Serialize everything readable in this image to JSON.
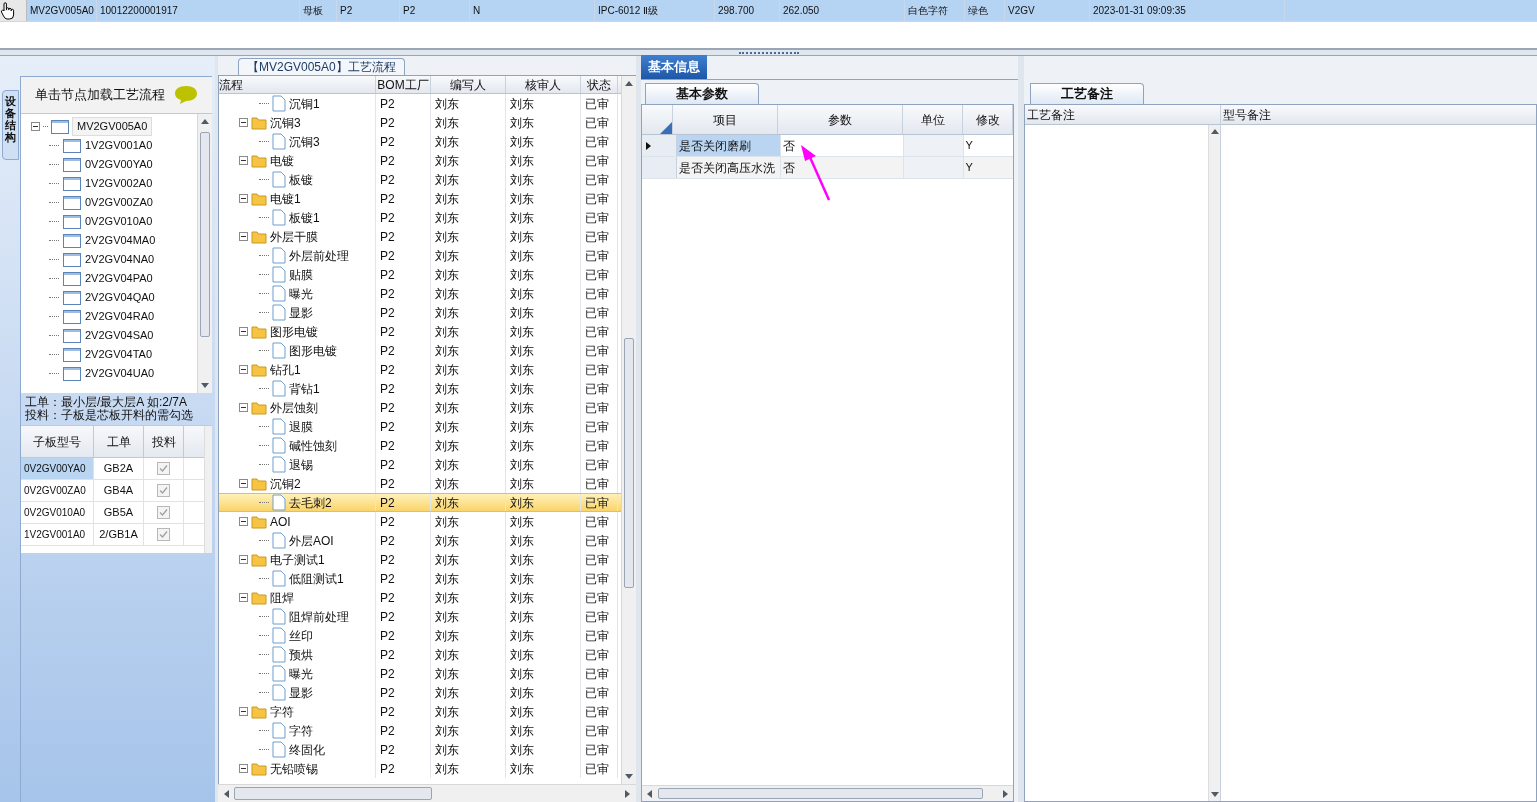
{
  "top_grid": {
    "row": {
      "selected": true,
      "cells": [
        "MV2GV005A0",
        "10012200001917",
        "母板",
        "P2",
        "P2",
        "N",
        "IPC-6012 Ⅱ级",
        "298.700",
        "262.050",
        "白色字符",
        "绿色",
        "V2GV",
        "2023-01-31 09:09:35"
      ]
    }
  },
  "left_panel": {
    "side_tab": "设备结构",
    "header": "单击节点加载工艺流程",
    "tree": {
      "label": "MV2GV005A0",
      "expanded": true,
      "selected": true,
      "children": [
        {
          "label": "1V2GV001A0"
        },
        {
          "label": "0V2GV00YA0"
        },
        {
          "label": "1V2GV002A0"
        },
        {
          "label": "0V2GV00ZA0"
        },
        {
          "label": "0V2GV010A0"
        },
        {
          "label": "2V2GV04MA0"
        },
        {
          "label": "2V2GV04NA0"
        },
        {
          "label": "2V2GV04PA0"
        },
        {
          "label": "2V2GV04QA0"
        },
        {
          "label": "2V2GV04RA0"
        },
        {
          "label": "2V2GV04SA0"
        },
        {
          "label": "2V2GV04TA0"
        },
        {
          "label": "2V2GV04UA0"
        }
      ]
    },
    "note": [
      "工单：最小层/最大层A 如:2/7A",
      "投料：子板是芯板开料的需勾选"
    ],
    "sub_grid": {
      "columns": [
        "子板型号",
        "工单",
        "投料"
      ],
      "rows": [
        {
          "model": "0V2GV00YA0",
          "order": "GB2A",
          "checked": true,
          "selected": true
        },
        {
          "model": "0V2GV00ZA0",
          "order": "GB4A",
          "checked": true,
          "selected": false
        },
        {
          "model": "0V2GV010A0",
          "order": "GB5A",
          "checked": true,
          "selected": false
        },
        {
          "model": "1V2GV001A0",
          "order": "2/GB1A",
          "checked": true,
          "selected": false
        }
      ]
    }
  },
  "flow": {
    "title": "【MV2GV005A0】工艺流程",
    "columns": [
      "流程",
      "BOM工厂",
      "编写人",
      "核审人",
      "状态"
    ],
    "rows": [
      {
        "children": [
          {
            "label": "沉铜1",
            "bom": "P2",
            "writer": "刘东",
            "reviewer": "刘东",
            "status": "已审",
            "selected": false
          }
        ]
      },
      {
        "label": "沉铜3",
        "expanded": true,
        "bom": "P2",
        "writer": "刘东",
        "reviewer": "刘东",
        "status": "已审",
        "selected": false,
        "children": [
          {
            "label": "沉铜3",
            "bom": "P2",
            "writer": "刘东",
            "reviewer": "刘东",
            "status": "已审",
            "selected": false
          }
        ]
      },
      {
        "label": "电镀",
        "expanded": true,
        "bom": "P2",
        "writer": "刘东",
        "reviewer": "刘东",
        "status": "已审",
        "selected": false,
        "children": [
          {
            "label": "板镀",
            "bom": "P2",
            "writer": "刘东",
            "reviewer": "刘东",
            "status": "已审",
            "selected": false
          }
        ]
      },
      {
        "label": "电镀1",
        "expanded": true,
        "bom": "P2",
        "writer": "刘东",
        "reviewer": "刘东",
        "status": "已审",
        "selected": false,
        "children": [
          {
            "label": "板镀1",
            "bom": "P2",
            "writer": "刘东",
            "reviewer": "刘东",
            "status": "已审",
            "selected": false
          }
        ]
      },
      {
        "label": "外层干膜",
        "expanded": true,
        "bom": "P2",
        "writer": "刘东",
        "reviewer": "刘东",
        "status": "已审",
        "selected": false,
        "children": [
          {
            "label": "外层前处理",
            "bom": "P2",
            "writer": "刘东",
            "reviewer": "刘东",
            "status": "已审",
            "selected": false
          },
          {
            "label": "贴膜",
            "bom": "P2",
            "writer": "刘东",
            "reviewer": "刘东",
            "status": "已审",
            "selected": false
          },
          {
            "label": "曝光",
            "bom": "P2",
            "writer": "刘东",
            "reviewer": "刘东",
            "status": "已审",
            "selected": false
          },
          {
            "label": "显影",
            "bom": "P2",
            "writer": "刘东",
            "reviewer": "刘东",
            "status": "已审",
            "selected": false
          }
        ]
      },
      {
        "label": "图形电镀",
        "expanded": true,
        "bom": "P2",
        "writer": "刘东",
        "reviewer": "刘东",
        "status": "已审",
        "selected": false,
        "children": [
          {
            "label": "图形电镀",
            "bom": "P2",
            "writer": "刘东",
            "reviewer": "刘东",
            "status": "已审",
            "selected": false
          }
        ]
      },
      {
        "label": "钻孔1",
        "expanded": true,
        "bom": "P2",
        "writer": "刘东",
        "reviewer": "刘东",
        "status": "已审",
        "selected": false,
        "children": [
          {
            "label": "背钻1",
            "bom": "P2",
            "writer": "刘东",
            "reviewer": "刘东",
            "status": "已审",
            "selected": false
          }
        ]
      },
      {
        "label": "外层蚀刻",
        "expanded": true,
        "bom": "P2",
        "writer": "刘东",
        "reviewer": "刘东",
        "status": "已审",
        "selected": false,
        "children": [
          {
            "label": "退膜",
            "bom": "P2",
            "writer": "刘东",
            "reviewer": "刘东",
            "status": "已审",
            "selected": false
          },
          {
            "label": "碱性蚀刻",
            "bom": "P2",
            "writer": "刘东",
            "reviewer": "刘东",
            "status": "已审",
            "selected": false
          },
          {
            "label": "退锡",
            "bom": "P2",
            "writer": "刘东",
            "reviewer": "刘东",
            "status": "已审",
            "selected": false
          }
        ]
      },
      {
        "label": "沉铜2",
        "expanded": true,
        "bom": "P2",
        "writer": "刘东",
        "reviewer": "刘东",
        "status": "已审",
        "selected": false,
        "children": [
          {
            "label": "去毛刺2",
            "bom": "P2",
            "writer": "刘东",
            "reviewer": "刘东",
            "status": "已审",
            "selected": true
          }
        ]
      },
      {
        "label": "AOI",
        "expanded": true,
        "bom": "P2",
        "writer": "刘东",
        "reviewer": "刘东",
        "status": "已审",
        "selected": false,
        "children": [
          {
            "label": "外层AOI",
            "bom": "P2",
            "writer": "刘东",
            "reviewer": "刘东",
            "status": "已审",
            "selected": false
          }
        ]
      },
      {
        "label": "电子测试1",
        "expanded": true,
        "bom": "P2",
        "writer": "刘东",
        "reviewer": "刘东",
        "status": "已审",
        "selected": false,
        "children": [
          {
            "label": "低阻测试1",
            "bom": "P2",
            "writer": "刘东",
            "reviewer": "刘东",
            "status": "已审",
            "selected": false
          }
        ]
      },
      {
        "label": "阻焊",
        "expanded": true,
        "bom": "P2",
        "writer": "刘东",
        "reviewer": "刘东",
        "status": "已审",
        "selected": false,
        "children": [
          {
            "label": "阻焊前处理",
            "bom": "P2",
            "writer": "刘东",
            "reviewer": "刘东",
            "status": "已审",
            "selected": false
          },
          {
            "label": "丝印",
            "bom": "P2",
            "writer": "刘东",
            "reviewer": "刘东",
            "status": "已审",
            "selected": false
          },
          {
            "label": "预烘",
            "bom": "P2",
            "writer": "刘东",
            "reviewer": "刘东",
            "status": "已审",
            "selected": false
          },
          {
            "label": "曝光",
            "bom": "P2",
            "writer": "刘东",
            "reviewer": "刘东",
            "status": "已审",
            "selected": false
          },
          {
            "label": "显影",
            "bom": "P2",
            "writer": "刘东",
            "reviewer": "刘东",
            "status": "已审",
            "selected": false
          }
        ]
      },
      {
        "label": "字符",
        "expanded": true,
        "bom": "P2",
        "writer": "刘东",
        "reviewer": "刘东",
        "status": "已审",
        "selected": false,
        "children": [
          {
            "label": "字符",
            "bom": "P2",
            "writer": "刘东",
            "reviewer": "刘东",
            "status": "已审",
            "selected": false
          },
          {
            "label": "终固化",
            "bom": "P2",
            "writer": "刘东",
            "reviewer": "刘东",
            "status": "已审",
            "selected": false
          }
        ]
      },
      {
        "label": "无铅喷锡",
        "expanded": true,
        "bom": "P2",
        "writer": "刘东",
        "reviewer": "刘东",
        "status": "已审",
        "selected": false
      }
    ]
  },
  "info": {
    "tabs": [
      {
        "label": "基本信息",
        "selected": true
      }
    ],
    "sub_tabs": [
      {
        "label": "基本参数",
        "selected": true
      }
    ],
    "columns": [
      "项目",
      "参数",
      "单位",
      "修改"
    ],
    "rows": [
      {
        "item": "是否关闭磨刷",
        "param": "否",
        "modify": "Y",
        "selected": true
      },
      {
        "item": "是否关闭高压水洗",
        "param": "否",
        "modify": "Y",
        "selected": false
      }
    ]
  },
  "remarks": {
    "tabs": [
      {
        "label": "工艺备注",
        "selected": true
      }
    ],
    "columns": [
      "工艺备注",
      "型号备注"
    ]
  }
}
